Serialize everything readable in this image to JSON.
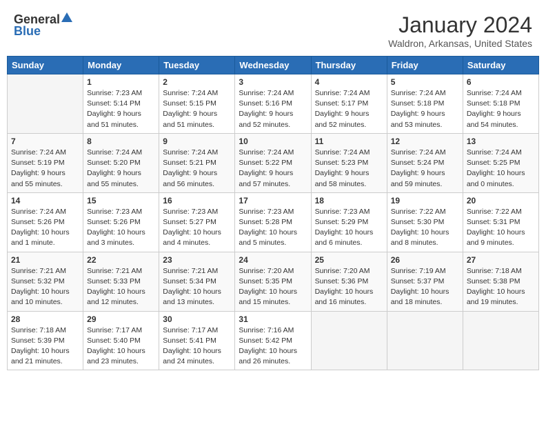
{
  "header": {
    "logo_general": "General",
    "logo_blue": "Blue",
    "month": "January 2024",
    "location": "Waldron, Arkansas, United States"
  },
  "weekdays": [
    "Sunday",
    "Monday",
    "Tuesday",
    "Wednesday",
    "Thursday",
    "Friday",
    "Saturday"
  ],
  "weeks": [
    [
      {
        "day": "",
        "info": ""
      },
      {
        "day": "1",
        "info": "Sunrise: 7:23 AM\nSunset: 5:14 PM\nDaylight: 9 hours\nand 51 minutes."
      },
      {
        "day": "2",
        "info": "Sunrise: 7:24 AM\nSunset: 5:15 PM\nDaylight: 9 hours\nand 51 minutes."
      },
      {
        "day": "3",
        "info": "Sunrise: 7:24 AM\nSunset: 5:16 PM\nDaylight: 9 hours\nand 52 minutes."
      },
      {
        "day": "4",
        "info": "Sunrise: 7:24 AM\nSunset: 5:17 PM\nDaylight: 9 hours\nand 52 minutes."
      },
      {
        "day": "5",
        "info": "Sunrise: 7:24 AM\nSunset: 5:18 PM\nDaylight: 9 hours\nand 53 minutes."
      },
      {
        "day": "6",
        "info": "Sunrise: 7:24 AM\nSunset: 5:18 PM\nDaylight: 9 hours\nand 54 minutes."
      }
    ],
    [
      {
        "day": "7",
        "info": "Sunrise: 7:24 AM\nSunset: 5:19 PM\nDaylight: 9 hours\nand 55 minutes."
      },
      {
        "day": "8",
        "info": "Sunrise: 7:24 AM\nSunset: 5:20 PM\nDaylight: 9 hours\nand 55 minutes."
      },
      {
        "day": "9",
        "info": "Sunrise: 7:24 AM\nSunset: 5:21 PM\nDaylight: 9 hours\nand 56 minutes."
      },
      {
        "day": "10",
        "info": "Sunrise: 7:24 AM\nSunset: 5:22 PM\nDaylight: 9 hours\nand 57 minutes."
      },
      {
        "day": "11",
        "info": "Sunrise: 7:24 AM\nSunset: 5:23 PM\nDaylight: 9 hours\nand 58 minutes."
      },
      {
        "day": "12",
        "info": "Sunrise: 7:24 AM\nSunset: 5:24 PM\nDaylight: 9 hours\nand 59 minutes."
      },
      {
        "day": "13",
        "info": "Sunrise: 7:24 AM\nSunset: 5:25 PM\nDaylight: 10 hours\nand 0 minutes."
      }
    ],
    [
      {
        "day": "14",
        "info": "Sunrise: 7:24 AM\nSunset: 5:26 PM\nDaylight: 10 hours\nand 1 minute."
      },
      {
        "day": "15",
        "info": "Sunrise: 7:23 AM\nSunset: 5:26 PM\nDaylight: 10 hours\nand 3 minutes."
      },
      {
        "day": "16",
        "info": "Sunrise: 7:23 AM\nSunset: 5:27 PM\nDaylight: 10 hours\nand 4 minutes."
      },
      {
        "day": "17",
        "info": "Sunrise: 7:23 AM\nSunset: 5:28 PM\nDaylight: 10 hours\nand 5 minutes."
      },
      {
        "day": "18",
        "info": "Sunrise: 7:23 AM\nSunset: 5:29 PM\nDaylight: 10 hours\nand 6 minutes."
      },
      {
        "day": "19",
        "info": "Sunrise: 7:22 AM\nSunset: 5:30 PM\nDaylight: 10 hours\nand 8 minutes."
      },
      {
        "day": "20",
        "info": "Sunrise: 7:22 AM\nSunset: 5:31 PM\nDaylight: 10 hours\nand 9 minutes."
      }
    ],
    [
      {
        "day": "21",
        "info": "Sunrise: 7:21 AM\nSunset: 5:32 PM\nDaylight: 10 hours\nand 10 minutes."
      },
      {
        "day": "22",
        "info": "Sunrise: 7:21 AM\nSunset: 5:33 PM\nDaylight: 10 hours\nand 12 minutes."
      },
      {
        "day": "23",
        "info": "Sunrise: 7:21 AM\nSunset: 5:34 PM\nDaylight: 10 hours\nand 13 minutes."
      },
      {
        "day": "24",
        "info": "Sunrise: 7:20 AM\nSunset: 5:35 PM\nDaylight: 10 hours\nand 15 minutes."
      },
      {
        "day": "25",
        "info": "Sunrise: 7:20 AM\nSunset: 5:36 PM\nDaylight: 10 hours\nand 16 minutes."
      },
      {
        "day": "26",
        "info": "Sunrise: 7:19 AM\nSunset: 5:37 PM\nDaylight: 10 hours\nand 18 minutes."
      },
      {
        "day": "27",
        "info": "Sunrise: 7:18 AM\nSunset: 5:38 PM\nDaylight: 10 hours\nand 19 minutes."
      }
    ],
    [
      {
        "day": "28",
        "info": "Sunrise: 7:18 AM\nSunset: 5:39 PM\nDaylight: 10 hours\nand 21 minutes."
      },
      {
        "day": "29",
        "info": "Sunrise: 7:17 AM\nSunset: 5:40 PM\nDaylight: 10 hours\nand 23 minutes."
      },
      {
        "day": "30",
        "info": "Sunrise: 7:17 AM\nSunset: 5:41 PM\nDaylight: 10 hours\nand 24 minutes."
      },
      {
        "day": "31",
        "info": "Sunrise: 7:16 AM\nSunset: 5:42 PM\nDaylight: 10 hours\nand 26 minutes."
      },
      {
        "day": "",
        "info": ""
      },
      {
        "day": "",
        "info": ""
      },
      {
        "day": "",
        "info": ""
      }
    ]
  ]
}
